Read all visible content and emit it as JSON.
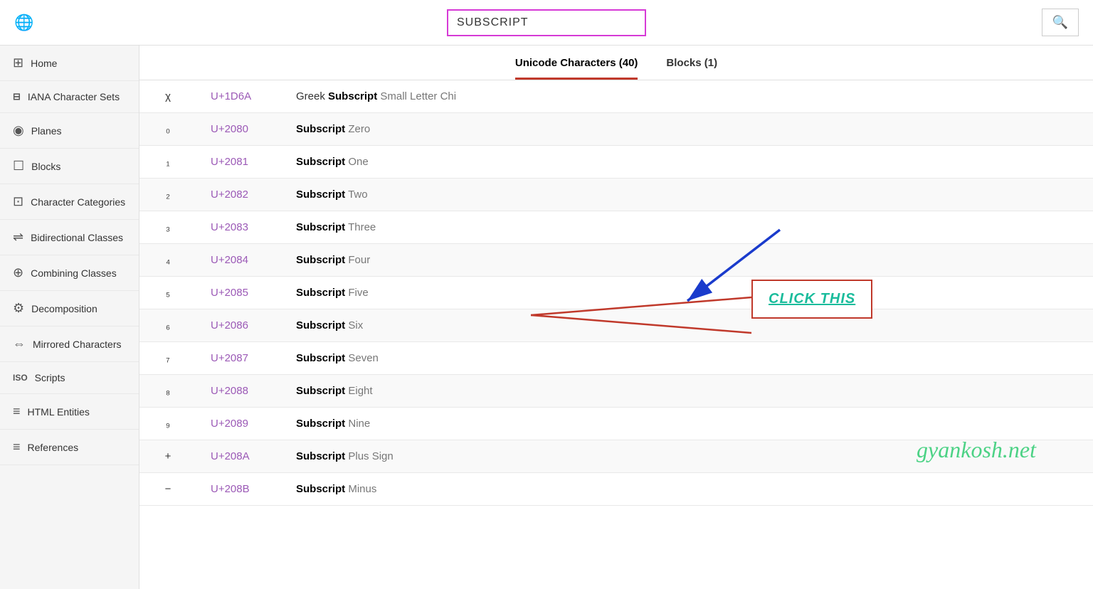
{
  "header": {
    "search_value": "SUBSCRIPT",
    "search_placeholder": "SUBSCRIPT",
    "globe_icon": "🌐",
    "search_icon": "🔍"
  },
  "tabs": [
    {
      "label": "Unicode Characters (40)",
      "active": true
    },
    {
      "label": "Blocks (1)",
      "active": false
    }
  ],
  "sidebar": {
    "items": [
      {
        "icon": "⊞",
        "label": "Home"
      },
      {
        "icon": "⊟",
        "label": "IANA Character Sets"
      },
      {
        "icon": "◉",
        "label": "Planes"
      },
      {
        "icon": "☐",
        "label": "Blocks"
      },
      {
        "icon": "⊡",
        "label": "Character Categories"
      },
      {
        "icon": "⇌",
        "label": "Bidirectional Classes"
      },
      {
        "icon": "⊕",
        "label": "Combining Classes"
      },
      {
        "icon": "⚙",
        "label": "Decomposition"
      },
      {
        "icon": "⇔",
        "label": "Mirrored Characters"
      },
      {
        "icon": "ISO",
        "label": "Scripts"
      },
      {
        "icon": "≡",
        "label": "HTML Entities"
      },
      {
        "icon": "≡",
        "label": "References"
      }
    ]
  },
  "table": {
    "rows": [
      {
        "char": "χ",
        "code": "U+1D6A",
        "name_bold": "Greek ",
        "name_highlight": "Subscript",
        "name_rest": " Small Letter Chi"
      },
      {
        "char": "₀",
        "code": "U+2080",
        "name_bold": "",
        "name_highlight": "Subscript",
        "name_rest": " Zero"
      },
      {
        "char": "₁",
        "code": "U+2081",
        "name_bold": "",
        "name_highlight": "Subscript",
        "name_rest": " One"
      },
      {
        "char": "₂",
        "code": "U+2082",
        "name_bold": "",
        "name_highlight": "Subscript",
        "name_rest": " Two"
      },
      {
        "char": "₃",
        "code": "U+2083",
        "name_bold": "",
        "name_highlight": "Subscript",
        "name_rest": " Three"
      },
      {
        "char": "₄",
        "code": "U+2084",
        "name_bold": "",
        "name_highlight": "Subscript",
        "name_rest": " Four"
      },
      {
        "char": "₅",
        "code": "U+2085",
        "name_bold": "",
        "name_highlight": "Subscript",
        "name_rest": " Five"
      },
      {
        "char": "₆",
        "code": "U+2086",
        "name_bold": "",
        "name_highlight": "Subscript",
        "name_rest": " Six"
      },
      {
        "char": "₇",
        "code": "U+2087",
        "name_bold": "",
        "name_highlight": "Subscript",
        "name_rest": " Seven"
      },
      {
        "char": "₈",
        "code": "U+2088",
        "name_bold": "",
        "name_highlight": "Subscript",
        "name_rest": " Eight"
      },
      {
        "char": "₉",
        "code": "U+2089",
        "name_bold": "",
        "name_highlight": "Subscript",
        "name_rest": " Nine"
      },
      {
        "char": "+",
        "code": "U+208A",
        "name_bold": "",
        "name_highlight": "Subscript",
        "name_rest": " Plus Sign"
      },
      {
        "char": "−",
        "code": "U+208B",
        "name_bold": "",
        "name_highlight": "Subscript",
        "name_rest": " Minus"
      }
    ]
  },
  "annotation": {
    "click_label": "CLICK THIS"
  },
  "watermark": "gyankosh.net"
}
